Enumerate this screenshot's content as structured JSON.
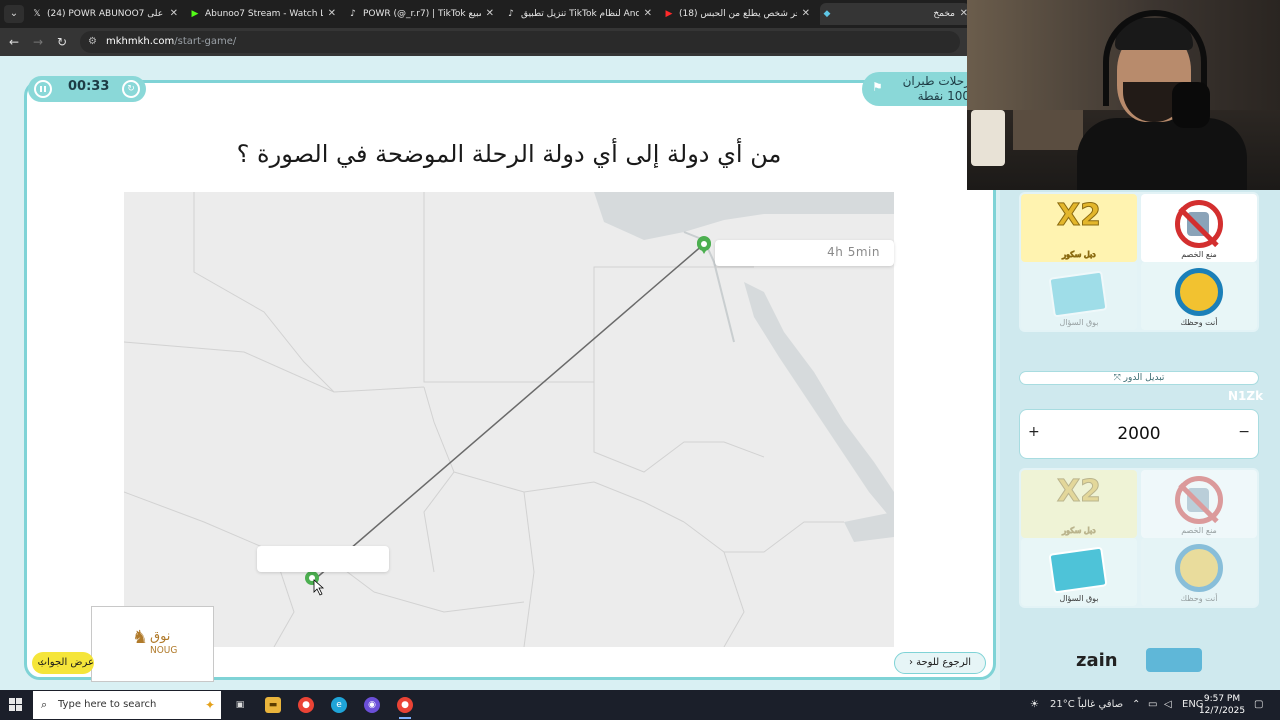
{
  "browser": {
    "tabs": [
      {
        "icon": "𝕏",
        "title": "(24) POWR ABUNOO7 على X: \"",
        "active": false
      },
      {
        "icon": "▶",
        "title": "Abunoo7 Stream - Watch Live on",
        "active": false
      },
      {
        "icon": "♪",
        "title": "POWR (@_r.r7) | TikTok أبو سبيع",
        "active": false
      },
      {
        "icon": "♪",
        "title": "تنزيل تطبيق TikTok لنظام Android",
        "active": false
      },
      {
        "icon": "▶",
        "title": "(18) اخر شخص يطلع من الحبس",
        "active": false
      },
      {
        "icon": "◆",
        "title": "مخمخ",
        "active": true
      }
    ],
    "url_host": "mkhmkh.com",
    "url_path": "/start-game/"
  },
  "game": {
    "timer": "00:33",
    "category_name": "رحلات طيران",
    "category_points": "100 نقطة",
    "question": "من أي دولة إلى أي دولة الرحلة الموضحة في الصورة ؟",
    "flight_duration": "4h 5min",
    "answer_button": "عرض الجواب",
    "back_button": "الرجوع للوحة",
    "sponsor_logo_ar": "نوق",
    "sponsor_logo_en": "NOUG"
  },
  "side_panel": {
    "team_top": {
      "lifelines": [
        {
          "name": "x2",
          "label": "X2",
          "caption": "دبل سكور",
          "used": false
        },
        {
          "name": "block-opponent",
          "caption": "منع الخصم",
          "used": false
        },
        {
          "name": "call-question",
          "caption": "بوق السؤال",
          "used": true
        },
        {
          "name": "luck-wheel",
          "caption": "أنت وحظك",
          "used": false
        }
      ]
    },
    "swap_turn": "تبديل الدور",
    "team_name": "N1Zk",
    "score": "2000",
    "plus": "+",
    "minus": "−",
    "team_bottom": {
      "lifelines": [
        {
          "name": "x2",
          "label": "X2",
          "caption": "دبل سكور",
          "used": true
        },
        {
          "name": "block-opponent",
          "caption": "منع الخصم",
          "used": true
        },
        {
          "name": "call-question",
          "caption": "بوق السؤال",
          "used": false
        },
        {
          "name": "luck-wheel",
          "caption": "أنت وحظك",
          "used": true
        }
      ]
    },
    "sponsor": "zain"
  },
  "taskbar": {
    "search_placeholder": "Type here to search",
    "weather": "21°C صافي غالباً",
    "language": "ENG",
    "time": "9:57 PM",
    "date": "12/7/2025"
  },
  "colors": {
    "accent": "#8ad8d8",
    "answer_button": "#f5e53a",
    "route_line": "#6a6a6a",
    "pin": "#4caf50"
  }
}
